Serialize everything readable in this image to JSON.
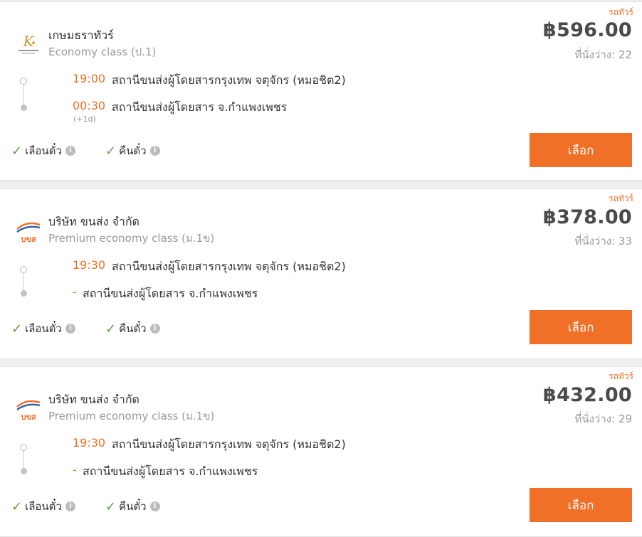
{
  "tag_label": "รถทัวร์",
  "select_label": "เลือก",
  "features": {
    "seat_select": "เลือนตั๋ว",
    "refund": "คืนตั๋ว"
  },
  "colors": {
    "accent": "#f07028",
    "check": "#5aa33c"
  },
  "trips": [
    {
      "operator": "เกษมธราทัวร์",
      "bus_class": "Economy class (ป.1)",
      "logo_icon": "kasemthara-logo",
      "price": "฿596.00",
      "seats": "ที่นั่งว่าง: 22",
      "depart_time": "19:00",
      "depart_station": "สถานีขนส่งผู้โดยสารกรุงเทพ จตุจักร (หมอชิต2)",
      "arrive_time": "00:30",
      "arrive_station": "สถานีขนส่งผู้โดยสาร จ.กำแพงเพชร",
      "day_offset": "(+1d)"
    },
    {
      "operator": "บริษัท ขนส่ง จำกัด",
      "bus_class": "Premium economy class (ม.1ข)",
      "logo_icon": "bks-logo",
      "price": "฿378.00",
      "seats": "ที่นั่งว่าง: 33",
      "depart_time": "19:30",
      "depart_station": "สถานีขนส่งผู้โดยสารกรุงเทพ จตุจักร (หมอชิต2)",
      "arrive_time": "-",
      "arrive_station": "สถานีขนส่งผู้โดยสาร จ.กำแพงเพชร",
      "day_offset": ""
    },
    {
      "operator": "บริษัท ขนส่ง จำกัด",
      "bus_class": "Premium economy class (ม.1ข)",
      "logo_icon": "bks-logo",
      "price": "฿432.00",
      "seats": "ที่นั่งว่าง: 29",
      "depart_time": "19:30",
      "depart_station": "สถานีขนส่งผู้โดยสารกรุงเทพ จตุจักร (หมอชิต2)",
      "arrive_time": "-",
      "arrive_station": "สถานีขนส่งผู้โดยสาร จ.กำแพงเพชร",
      "day_offset": ""
    }
  ]
}
